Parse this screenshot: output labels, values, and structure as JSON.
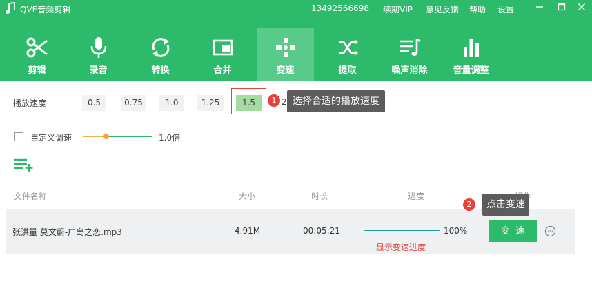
{
  "app": {
    "title": "QVE音频剪辑",
    "phone": "13492566698",
    "menu": [
      "续期VIP",
      "意见反馈",
      "帮助",
      "设置"
    ]
  },
  "toolbar": {
    "items": [
      {
        "label": "剪辑",
        "icon": "scissors-icon"
      },
      {
        "label": "录音",
        "icon": "microphone-icon"
      },
      {
        "label": "转换",
        "icon": "convert-icon"
      },
      {
        "label": "合并",
        "icon": "merge-icon"
      },
      {
        "label": "变速",
        "icon": "speed-icon",
        "active": true
      },
      {
        "label": "提取",
        "icon": "shuffle-icon"
      },
      {
        "label": "噪声消除",
        "icon": "noise-reduction-icon"
      },
      {
        "label": "音量调整",
        "icon": "volume-bars-icon"
      }
    ]
  },
  "speed": {
    "label": "播放速度",
    "options": [
      "0.5",
      "0.75",
      "1.0",
      "1.25",
      "1.5"
    ],
    "selected": "1.5",
    "partial_next": "2",
    "callout_number": "1",
    "callout_text": "选择合适的播放速度"
  },
  "custom": {
    "label": "自定义调速",
    "checked": false,
    "value": "1.0倍",
    "slider_level": 0.3
  },
  "table": {
    "headers": [
      "文件名称",
      "大小",
      "时长",
      "进度",
      "操作"
    ],
    "rows": [
      {
        "name": "张洪量 莫文蔚-广岛之恋.mp3",
        "size": "4.91M",
        "duration": "00:05:21",
        "progress_text": "100%",
        "progress": 1.0,
        "note": "显示变速进度",
        "action": "变 速"
      }
    ],
    "callout_number": "2",
    "callout_text": "点击变速"
  },
  "colors": {
    "brand": "#2dbb6b",
    "active_tab": "#58cb8b",
    "selected_chip": "#a6dba0",
    "highlight_red": "#e0463f"
  }
}
